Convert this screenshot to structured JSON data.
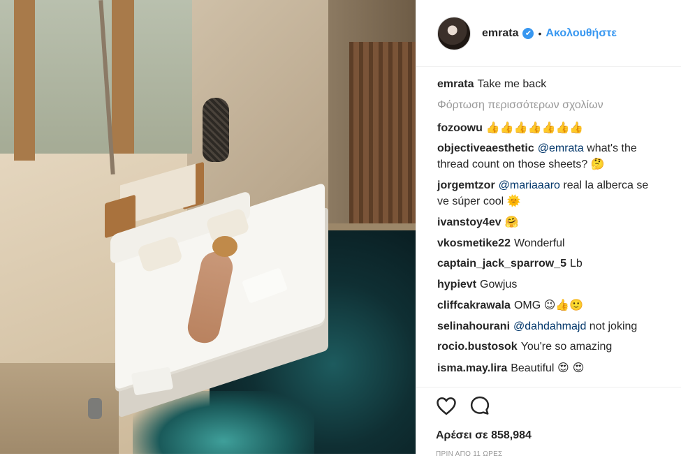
{
  "header": {
    "username": "emrata",
    "verified_glyph": "✔",
    "separator": "•",
    "follow_label": "Ακολουθήστε"
  },
  "caption": {
    "user": "emrata",
    "text": "Take me back"
  },
  "load_more_label": "Φόρτωση περισσότερων σχολίων",
  "comments": [
    {
      "user": "fozoowu",
      "text": "",
      "emoji": "👍👍👍👍👍👍👍"
    },
    {
      "user": "objectiveaesthetic",
      "mention": "@emrata",
      "text": "what's the thread count on those sheets?",
      "emoji": "🤔"
    },
    {
      "user": "jorgemtzor",
      "mention": "@mariaaaro",
      "text": "real la alberca se ve súper cool",
      "emoji": "🌞"
    },
    {
      "user": "ivanstoy4ev",
      "text": "",
      "emoji": "🤗"
    },
    {
      "user": "vkosmetike22",
      "text": "Wonderful",
      "emoji": ""
    },
    {
      "user": "captain_jack_sparrow_5",
      "text": "Lb",
      "emoji": ""
    },
    {
      "user": "hypievt",
      "text": "Gowjus",
      "emoji": ""
    },
    {
      "user": "cliffcakrawala",
      "text": "OMG",
      "emoji": "😉👍🙂"
    },
    {
      "user": "selinahourani",
      "mention": "@dahdahmajd",
      "text": "not joking",
      "emoji": ""
    },
    {
      "user": "rocio.bustosok",
      "text": "You're so amazing",
      "emoji": ""
    },
    {
      "user": "isma.may.lira",
      "text": "Beautiful",
      "emoji": "😍 😍"
    }
  ],
  "actions": {
    "like_icon": "heart-icon",
    "comment_icon": "comment-bubble-icon",
    "likes_text": "Αρέσει σε 858,984",
    "timestamp": "ΠΡΙΝ ΑΠΟ 11 ΩΡΕΣ"
  },
  "colors": {
    "accent": "#3897f0",
    "mention": "#003569",
    "muted": "#999999",
    "text": "#262626"
  }
}
